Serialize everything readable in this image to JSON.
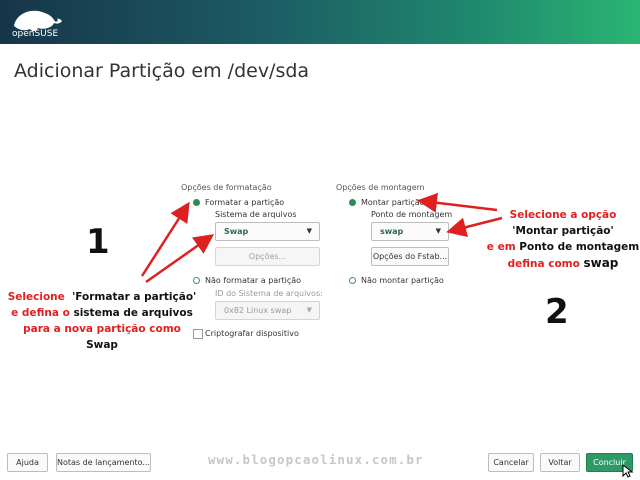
{
  "header": {
    "logo_text": "openSUSE"
  },
  "page_title": "Adicionar Partição em /dev/sda",
  "format_options": {
    "heading": "Opções de formatação",
    "format_label": "Formatar a partição",
    "filesystem_label": "Sistema de arquivos",
    "filesystem_value": "Swap",
    "options_button": "Opções...",
    "no_format_label": "Não formatar a partição",
    "fsid_label": "ID do Sistema de arquivos:",
    "fsid_value": "0x82 Linux swap",
    "encrypt_label": "Criptografar dispositivo"
  },
  "mount_options": {
    "heading": "Opções de montagem",
    "mount_label": "Montar partição",
    "mountpoint_label": "Ponto de montagem",
    "mountpoint_value": "swap",
    "fstab_button": "Opções do Fstab...",
    "no_mount_label": "Não montar partição"
  },
  "annotations": {
    "number_1": "1",
    "number_2": "2",
    "left_text": [
      "Selecione",
      "'Formatar a partição'",
      "e defina o",
      "sistema de arquivos",
      "para a nova partição como",
      "Swap"
    ],
    "right_text": [
      "Selecione  a opção",
      "'Montar partição'",
      "e em",
      "Ponto de montagem",
      "defina como",
      "swap"
    ]
  },
  "footer": {
    "help": "Ajuda",
    "release_notes": "Notas de lançamento...",
    "watermark": "www.blogopcaolinux.com.br",
    "cancel": "Cancelar",
    "back": "Voltar",
    "finish": "Concluir"
  },
  "colors": {
    "accent": "#2e9a67",
    "annotation_red": "#e02020"
  }
}
